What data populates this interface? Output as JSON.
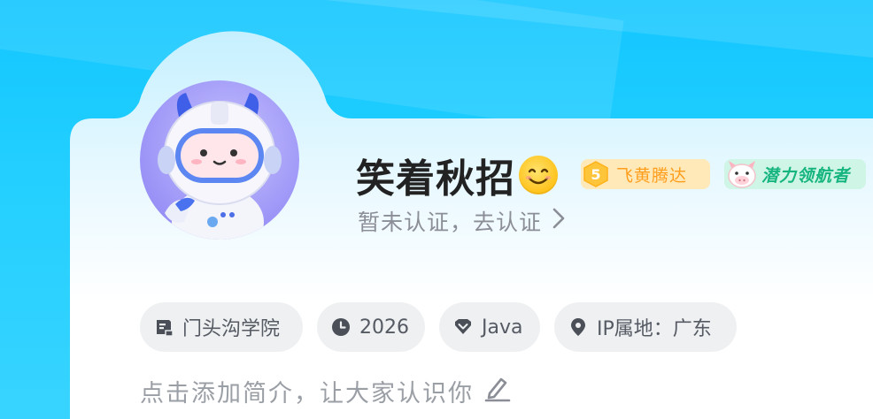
{
  "profile": {
    "username": "笑着秋招",
    "verify_text": "暂未认证，去认证",
    "badges": {
      "level_number": "5",
      "level_label": "飞黄腾达",
      "potential_label": "潜力领航者"
    }
  },
  "tags": {
    "school": "门头沟学院",
    "year": "2026",
    "skill": "Java",
    "ip_location": "IP属地：广东"
  },
  "intro": {
    "placeholder": "点击添加简介，让大家认识你"
  },
  "colors": {
    "sky": "#22cfff",
    "level_badge_text": "#ff9d1b",
    "potential_badge_text": "#16b57f",
    "secondary_text": "#8b8e96"
  },
  "icons": [
    "school-icon",
    "clock-icon",
    "heart-shield-icon",
    "location-pin-icon",
    "chevron-right-icon",
    "edit-pencil-icon",
    "smile-emoji-icon",
    "level-hexagon-icon",
    "cow-mascot-icon"
  ]
}
